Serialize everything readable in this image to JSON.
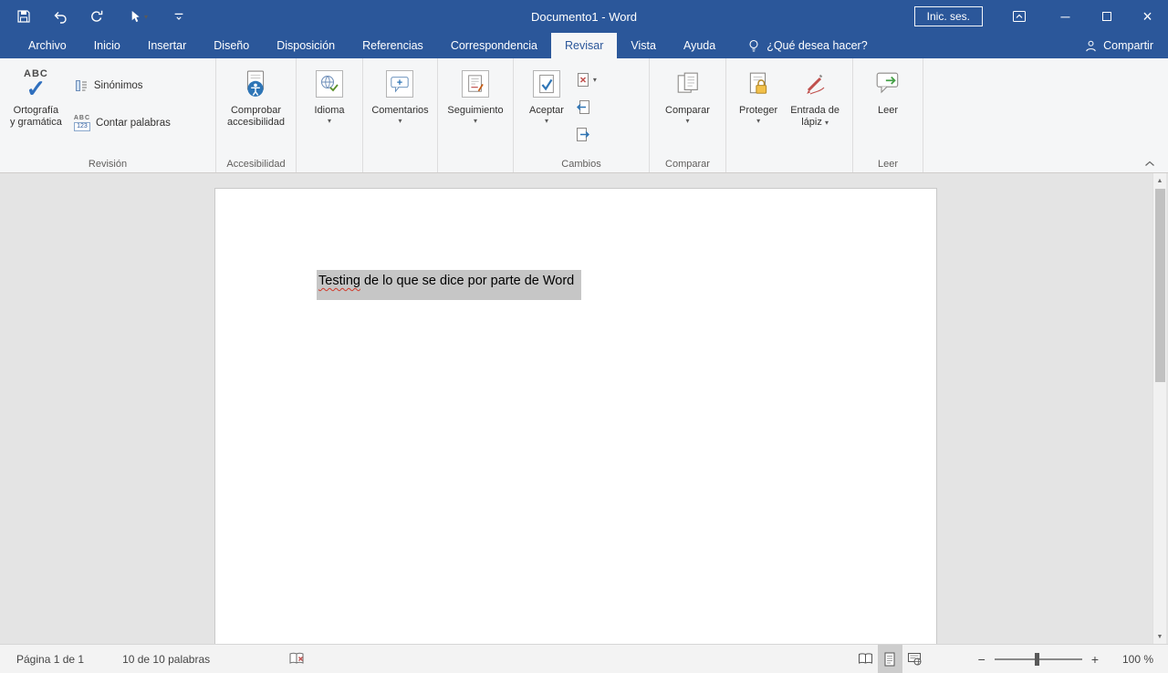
{
  "icons": {
    "chevron_down": "▾",
    "scroll_up": "▲",
    "scroll_down": "▼",
    "zoom_out": "−",
    "zoom_in": "+",
    "minimize": "─",
    "close": "×",
    "spell_abc": "ABC",
    "spell_check": "✓",
    "wc_abc": "ABC",
    "wc_123": "123"
  },
  "titlebar": {
    "title": "Documento1 - Word",
    "sign_in": "Inic. ses."
  },
  "tabs": [
    {
      "label": "Archivo"
    },
    {
      "label": "Inicio"
    },
    {
      "label": "Insertar"
    },
    {
      "label": "Diseño"
    },
    {
      "label": "Disposición"
    },
    {
      "label": "Referencias"
    },
    {
      "label": "Correspondencia"
    },
    {
      "label": "Revisar",
      "active": true
    },
    {
      "label": "Vista"
    },
    {
      "label": "Ayuda"
    }
  ],
  "tell_me": "¿Qué desea hacer?",
  "share": "Compartir",
  "ribbon": {
    "spelling": {
      "line1": "Ortografía",
      "line2": "y gramática"
    },
    "synonyms": "Sinónimos",
    "word_count": "Contar palabras",
    "accessibility": {
      "line1": "Comprobar",
      "line2": "accesibilidad"
    },
    "language": "Idioma",
    "comments": "Comentarios",
    "tracking": "Seguimiento",
    "accept": "Aceptar",
    "compare": "Comparar",
    "protect": "Proteger",
    "ink": {
      "line1": "Entrada de",
      "line2": "lápiz"
    },
    "read": "Leer",
    "labels": {
      "revision": "Revisión",
      "accessibility": "Accesibilidad",
      "changes": "Cambios",
      "compare": "Comparar",
      "read": "Leer"
    }
  },
  "document": {
    "text_word1": "Testing",
    "text_rest": " de lo que se dice por parte de Word"
  },
  "statusbar": {
    "page": "Página 1 de 1",
    "words": "10 de 10 palabras",
    "zoom": "100 %"
  }
}
